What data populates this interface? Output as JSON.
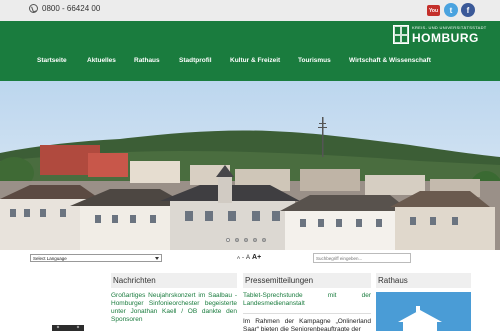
{
  "topbar": {
    "phone": "0800 - 66424 00",
    "youtube_label": "You",
    "twitter_label": "t",
    "facebook_label": "f"
  },
  "logo": {
    "small": "KREIS- UND UNIVERSITÄTSSTADT",
    "big": "HOMBURG"
  },
  "nav": [
    {
      "label": "Startseite"
    },
    {
      "label": "Aktuelles"
    },
    {
      "label": "Rathaus"
    },
    {
      "label": "Stadtprofil"
    },
    {
      "label": "Kultur & Freizeit"
    },
    {
      "label": "Tourismus"
    },
    {
      "label": "Wirtschaft & Wissenschaft"
    }
  ],
  "tools": {
    "language": "Select Language",
    "font_small": "A",
    "font_dash": "-",
    "font_normal": "A",
    "font_large": "A+",
    "search_placeholder": "Suchbegriff eingeben..."
  },
  "columns": {
    "news": {
      "title": "Nachrichten",
      "headline": "Großartiges Neujahrskonzert im Saalbau - Homburger Sinfonieorchester begeisterte unter Jonathan Kaell / OB dankte den Sponsoren"
    },
    "press": {
      "title": "Pressemitteilungen",
      "headline": "Tablet-Sprechstunde mit der Landesmedienanstalt",
      "teaser": "Im Rahmen der Kampagne „Onlinerland Saar“ bieten die Seniorenbeauftragte der"
    },
    "rathaus": {
      "title": "Rathaus"
    }
  },
  "colors": {
    "brand_green": "#1a7c3e",
    "topbar_bg": "#ececec",
    "link_green": "#1a7c3e"
  },
  "icons": {
    "phone": "phone-icon",
    "youtube": "youtube-icon",
    "twitter": "twitter-icon",
    "facebook": "facebook-icon",
    "dropdown": "chevron-down-icon"
  },
  "slider": {
    "slide_count": 5,
    "active_index": 0
  }
}
